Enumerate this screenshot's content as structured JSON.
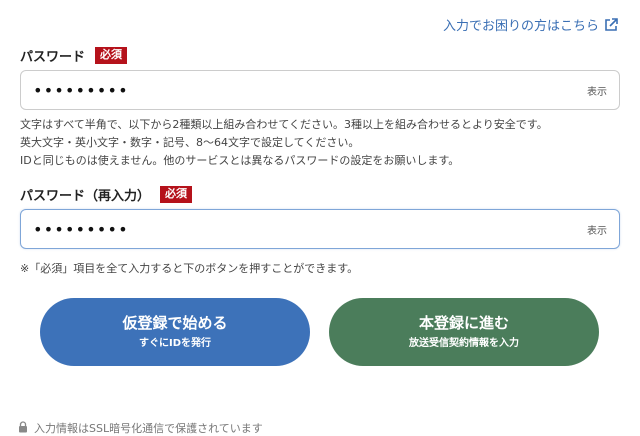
{
  "help_link": {
    "label": "入力でお困りの方はこちら",
    "icon": "external-link-icon"
  },
  "password": {
    "label": "パスワード",
    "required_badge": "必須",
    "value": "•••••••••",
    "toggle_label": "表示",
    "hints": [
      "文字はすべて半角で、以下から2種類以上組み合わせてください。3種以上を組み合わせるとより安全です。",
      "英大文字・英小文字・数字・記号、8〜64文字で設定してください。",
      "IDと同じものは使えません。他のサービスとは異なるパスワードの設定をお願いします。"
    ]
  },
  "password_confirm": {
    "label": "パスワード（再入力）",
    "required_badge": "必須",
    "value": "•••••••••",
    "toggle_label": "表示"
  },
  "note": "※「必須」項目を全て入力すると下のボタンを押すことができます。",
  "buttons": {
    "temp": {
      "main": "仮登録で始める",
      "sub": "すぐにIDを発行",
      "color": "#3d72b9"
    },
    "full": {
      "main": "本登録に進む",
      "sub": "放送受信契約情報を入力",
      "color": "#4b7d5b"
    }
  },
  "ssl_notice": {
    "text": "入力情報はSSL暗号化通信で保護されています",
    "icon": "lock-icon"
  },
  "colors": {
    "link": "#3a6fb4",
    "required": "#b5121b"
  }
}
